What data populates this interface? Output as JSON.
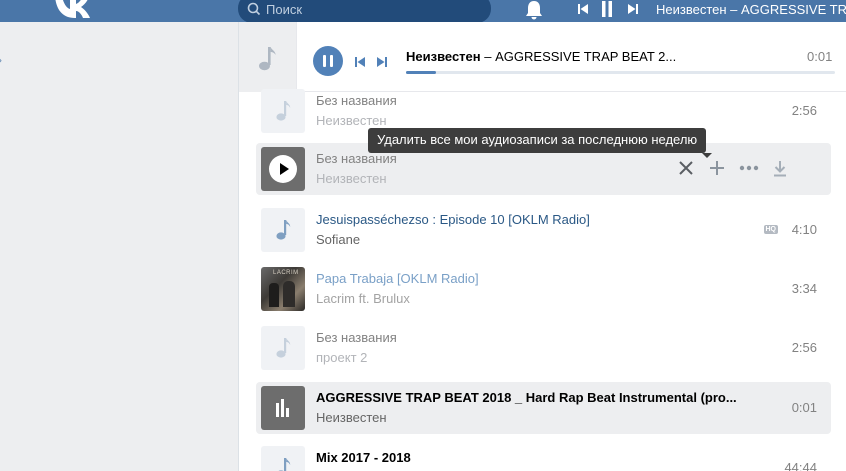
{
  "header": {
    "logo": "VK",
    "search": {
      "placeholder": "Поиск",
      "value": ""
    },
    "now_playing_title": "Неизвестен – AGGRESSIVE TRAP BEAT"
  },
  "player": {
    "artist": "Неизвестен",
    "separator": " – ",
    "title": "AGGRESSIVE TRAP BEAT 2...",
    "time": "0:01",
    "progress": 0.07
  },
  "tooltip": "Удалить все мои аудиозаписи за последнюю неделю",
  "tracks": [
    {
      "title": "Без названия",
      "artist": "Неизвестен",
      "duration": "2:56"
    },
    {
      "title": "Без названия",
      "artist": "Неизвестен",
      "duration": ""
    },
    {
      "title": "Jesuispasséchezso : Episode 10 [OKLM Radio]",
      "artist": "Sofiane",
      "duration": "4:10",
      "badge": "HQ"
    },
    {
      "title": "Papa Trabaja [OKLM Radio]",
      "artist": "Lacrim ft. Brulux",
      "duration": "3:34",
      "cover_text": "LACRIM"
    },
    {
      "title": "Без названия",
      "artist": "проект 2",
      "duration": "2:56"
    },
    {
      "title": "AGGRESSIVE TRAP BEAT 2018 _ Hard Rap Beat Instrumental (pro...",
      "artist": "Неизвестен",
      "duration": "0:01"
    },
    {
      "title": "Mix 2017 - 2018",
      "artist": "",
      "duration": "44:44"
    }
  ],
  "colors": {
    "brand": "#4a76a8",
    "accent": "#5181b8",
    "link": "#2a5885"
  }
}
